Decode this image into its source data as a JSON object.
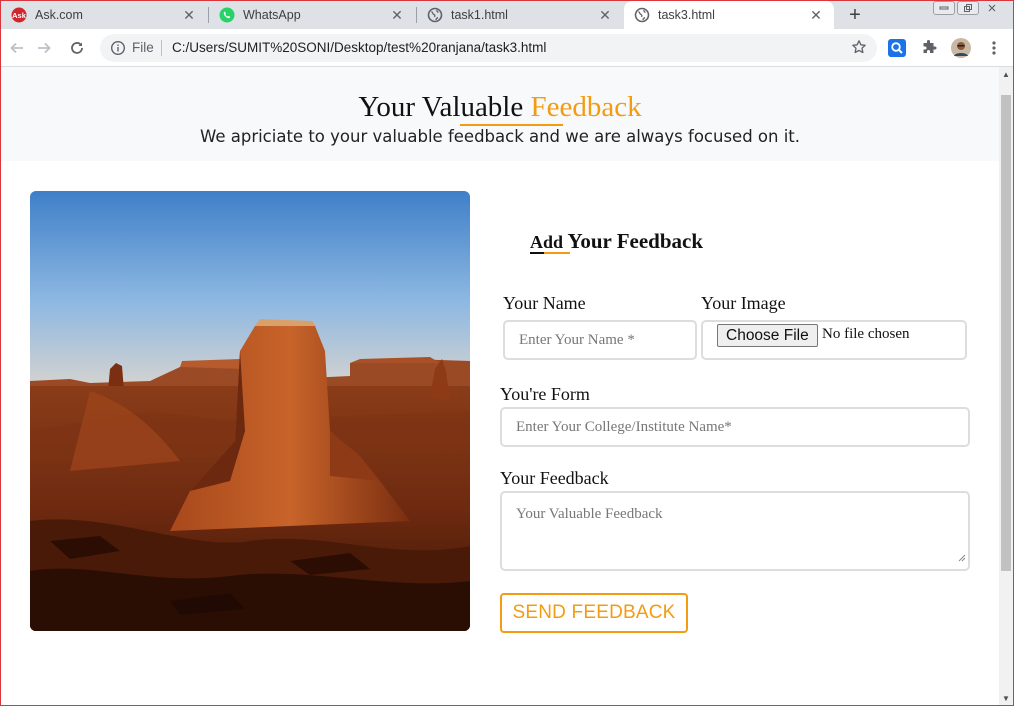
{
  "browser": {
    "tabs": [
      {
        "title": "Ask.com",
        "icon": "ask-icon"
      },
      {
        "title": "WhatsApp",
        "icon": "whatsapp-icon"
      },
      {
        "title": "task1.html",
        "icon": "globe-icon"
      },
      {
        "title": "task3.html",
        "icon": "globe-icon",
        "active": true
      }
    ],
    "new_tab": "+",
    "omnibox": {
      "scheme_label": "File",
      "url": "C:/Users/SUMIT%20SONI/Desktop/test%20ranjana/task3.html"
    }
  },
  "page": {
    "hero": {
      "title_main": "Your Valuable ",
      "title_accent": "Feedback",
      "subtitle": "We apriciate to your valuable feedback and we are always focused on it."
    },
    "photo": {
      "icon": "desert-butte-photo"
    },
    "form": {
      "title_small": "Add",
      "title_main": " Your Feedback",
      "name_label": "Your Name",
      "name_placeholder": "Enter Your Name *",
      "image_label": "Your Image",
      "file_button": "Choose File",
      "file_status": "No file chosen",
      "form_label": "You're Form",
      "college_placeholder": "Enter Your College/Institute Name*",
      "feedback_label": "Your Feedback",
      "feedback_placeholder": "Your Valuable Feedback",
      "submit_label": "SEND FEEDBACK"
    }
  },
  "colors": {
    "accent": "#f39c12",
    "frame": "#d9363e"
  }
}
